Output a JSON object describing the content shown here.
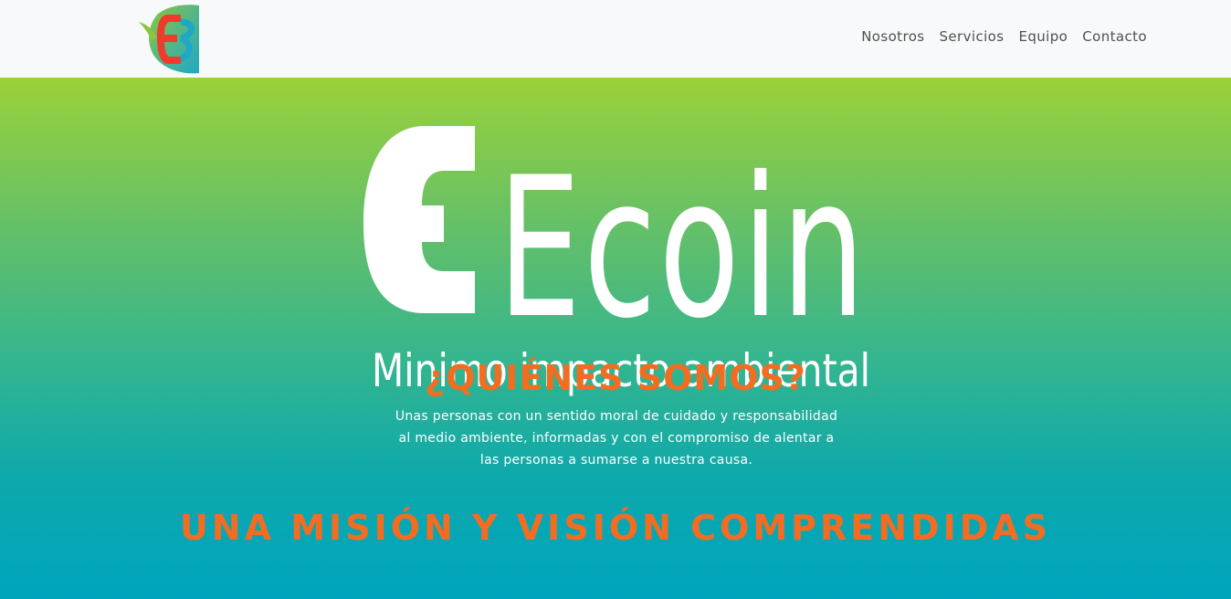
{
  "nav": {
    "logo_alt": "EB",
    "links": [
      "Nosotros",
      "Servicios",
      "Equipo",
      "Contacto"
    ]
  },
  "hero": {
    "title": "Ecoin",
    "tagline": "Minimo impacto ambiental"
  },
  "about": {
    "title": "¿QUIÉNES SOMOS?",
    "text": "Unas personas con un sentido moral de cuidado y responsabilidad al medio ambiente, informadas y con el compromiso de alentar a las personas a sumarse a nuestra causa."
  },
  "mission": {
    "title": "UNA MISIÓN Y VISIÓN COMPRENDIDAS"
  },
  "colors": {
    "accent": "#f26d21",
    "nav_bg": "#f8f9fa",
    "gradient_top": "#9bd13a",
    "gradient_bottom": "#00a5bd"
  }
}
